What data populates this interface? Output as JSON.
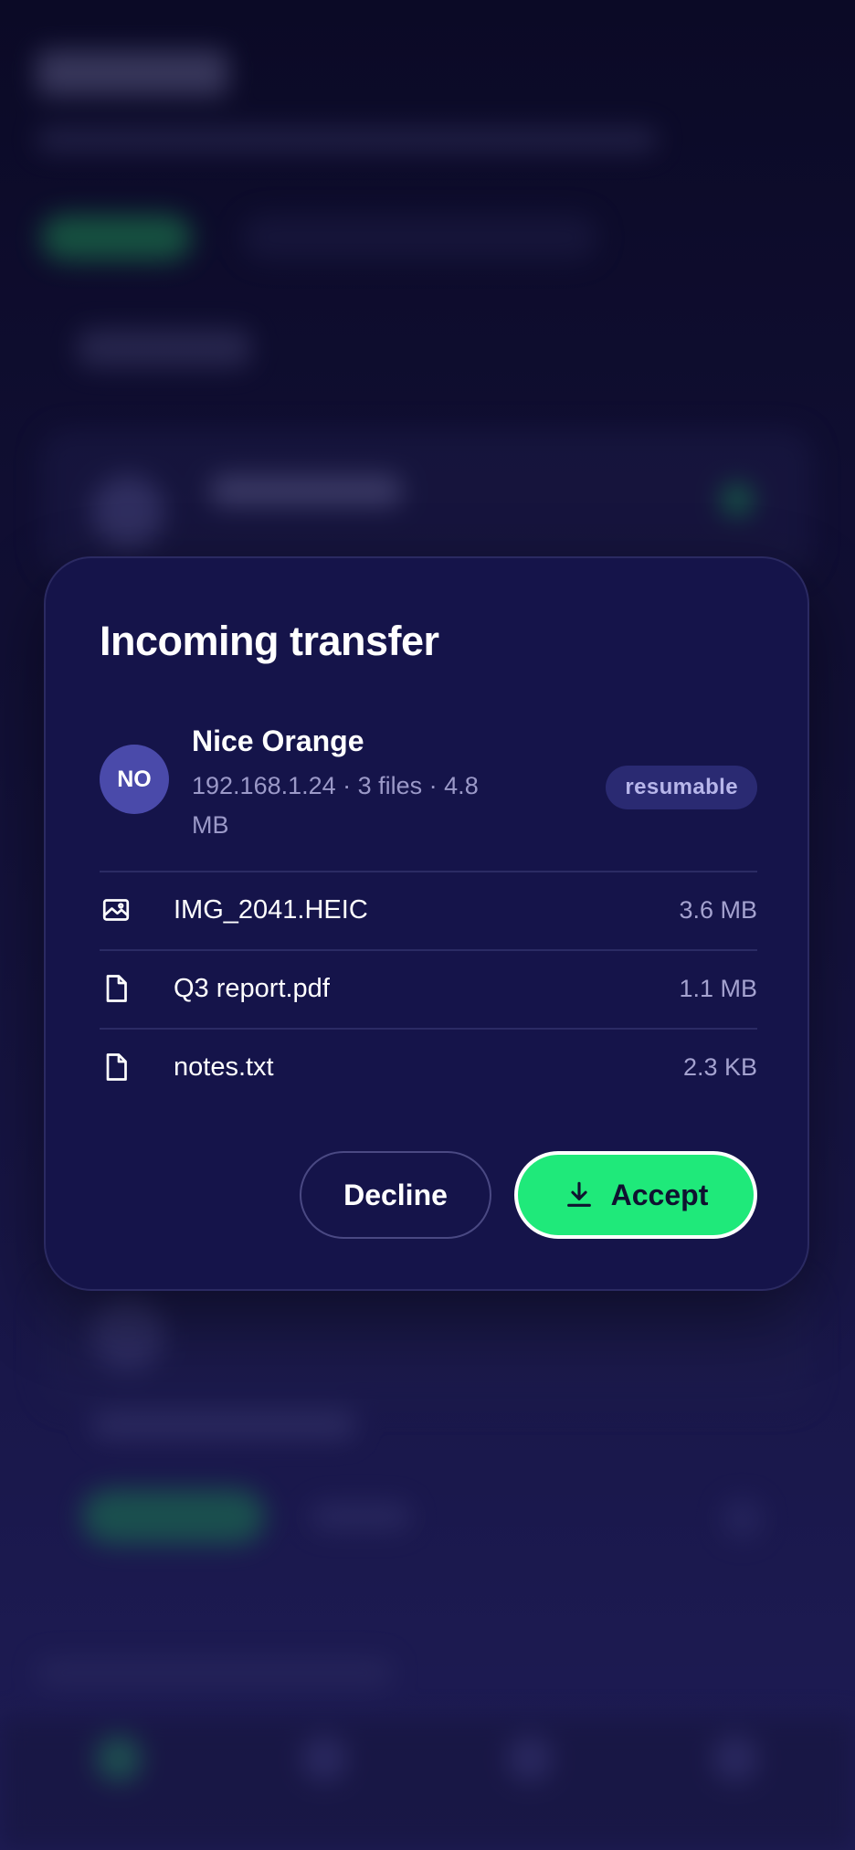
{
  "modal": {
    "title": "Incoming transfer",
    "sender": {
      "initials": "NO",
      "name": "Nice Orange",
      "meta": "192.168.1.24 · 3 files · 4.8 MB",
      "badge": "resumable"
    },
    "files": [
      {
        "icon": "image-file-icon",
        "name": "IMG_2041.HEIC",
        "size": "3.6 MB"
      },
      {
        "icon": "document-file-icon",
        "name": "Q3 report.pdf",
        "size": "1.1 MB"
      },
      {
        "icon": "document-file-icon",
        "name": "notes.txt",
        "size": "2.3 KB"
      }
    ],
    "actions": {
      "decline_label": "Decline",
      "accept_label": "Accept",
      "accept_icon": "download-icon"
    }
  },
  "colors": {
    "accent_green": "#1fe97a",
    "modal_bg": "#15144a",
    "avatar_bg": "#4a4aaa",
    "badge_bg": "#2a2a72"
  }
}
